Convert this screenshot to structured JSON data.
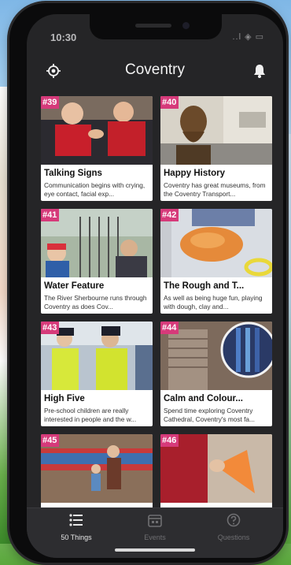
{
  "status": {
    "time": "10:30",
    "icons": "..l ◈ ▭"
  },
  "header": {
    "title": "Coventry",
    "left_icon": "locate-icon",
    "right_icon": "bell-icon"
  },
  "cards": [
    {
      "num": "#39",
      "title": "Talking Signs",
      "desc": "Communication begins with crying, eye contact, facial exp..."
    },
    {
      "num": "#40",
      "title": "Happy History",
      "desc": "Coventry has great museums, from the Coventry Transport..."
    },
    {
      "num": "#41",
      "title": "Water Feature",
      "desc": "The River Sherbourne runs through Coventry as does Cov..."
    },
    {
      "num": "#42",
      "title": "The Rough and T...",
      "desc": "As well as being huge fun, playing with dough, clay and..."
    },
    {
      "num": "#43",
      "title": "High Five",
      "desc": "Pre-school children are really interested in people and the w..."
    },
    {
      "num": "#44",
      "title": "Calm and Colour...",
      "desc": "Spend time exploring Coventry Cathedral, Coventry's most fa..."
    },
    {
      "num": "#45",
      "title": "",
      "desc": ""
    },
    {
      "num": "#46",
      "title": "",
      "desc": ""
    }
  ],
  "tabs": [
    {
      "label": "50 Things",
      "icon": "list-icon"
    },
    {
      "label": "Events",
      "icon": "calendar-icon"
    },
    {
      "label": "Questions",
      "icon": "question-icon"
    }
  ],
  "colors": {
    "badge": "#d63a7a",
    "screen_bg": "#252527",
    "tabbar_bg": "#2d2d30"
  }
}
